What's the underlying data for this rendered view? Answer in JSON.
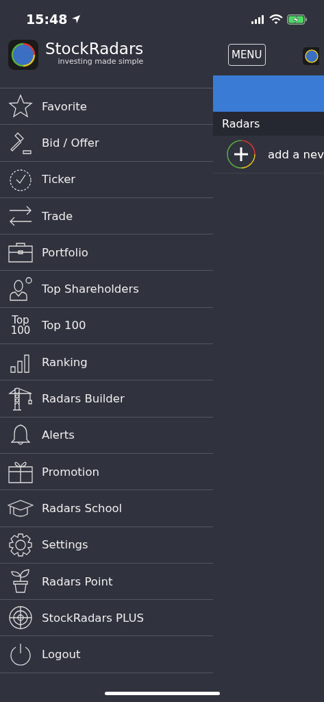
{
  "status_bar": {
    "time": "15:48"
  },
  "drawer": {
    "app_name": "StockRadars",
    "tagline": "investing made simple",
    "items": [
      {
        "label": "Favorite"
      },
      {
        "label": "Bid / Offer"
      },
      {
        "label": "Ticker"
      },
      {
        "label": "Trade"
      },
      {
        "label": "Portfolio"
      },
      {
        "label": "Top Shareholders"
      },
      {
        "label": "Top 100",
        "icon_text": [
          "Top",
          "100"
        ]
      },
      {
        "label": "Ranking"
      },
      {
        "label": "Radars Builder"
      },
      {
        "label": "Alerts"
      },
      {
        "label": "Promotion"
      },
      {
        "label": "Radars School"
      },
      {
        "label": "Settings"
      },
      {
        "label": "Radars Point"
      },
      {
        "label": "StockRadars PLUS"
      },
      {
        "label": "Logout"
      }
    ]
  },
  "main": {
    "menu_button": "MENU",
    "section_title": "Radars",
    "add_row": "add a nev"
  }
}
